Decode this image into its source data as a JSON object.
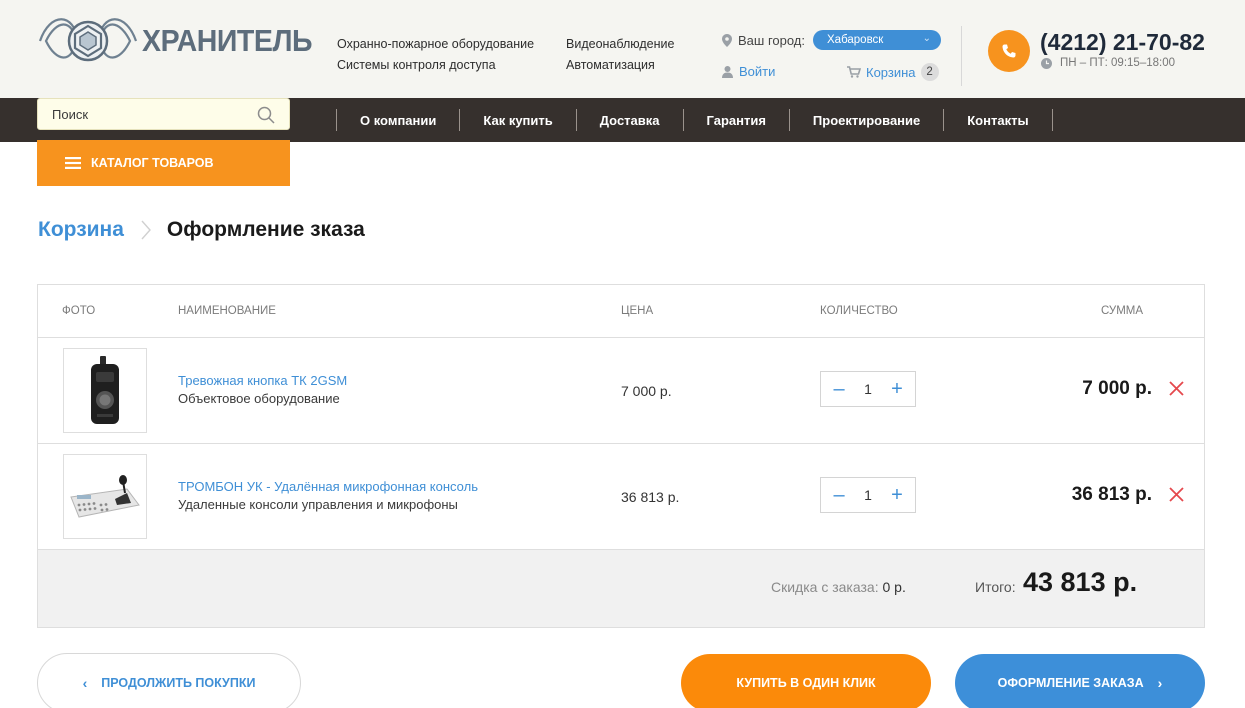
{
  "header": {
    "logo_text": "ХРАНИТЕЛЬ",
    "top_links_col1": [
      "Охранно-пожарное оборудование",
      "Системы контроля доступа"
    ],
    "top_links_col2": [
      "Видеонаблюдение",
      "Автоматизация"
    ],
    "city_label": "Ваш город:",
    "city_value": "Хабаровск",
    "login_label": "Войти",
    "cart_label": "Корзина",
    "cart_count": "2",
    "phone": "(4212) 21-70-82",
    "hours": "ПН – ПТ: 09:15–18:00"
  },
  "navbar": {
    "search_placeholder": "Поиск",
    "items": [
      "О компании",
      "Как купить",
      "Доставка",
      "Гарантия",
      "Проектирование",
      "Контакты"
    ]
  },
  "catalog_label": "КАТАЛОГ ТОВАРОВ",
  "breadcrumb": {
    "link": "Корзина",
    "current": "Оформление зказа"
  },
  "table": {
    "headers": [
      "ФОТО",
      "НАИМЕНОВАНИЕ",
      "ЦЕНА",
      "КОЛИЧЕСТВО",
      "СУММА"
    ],
    "rows": [
      {
        "name": "Тревожная кнопка ТК 2GSM",
        "category": "Объектовое оборудование",
        "price": "7 000 р.",
        "qty": "1",
        "sum": "7 000 р."
      },
      {
        "name": "ТРОМБОН УК - Удалённая микрофонная консоль",
        "category": "Удаленные консоли управления и микрофоны",
        "price": "36 813 р.",
        "qty": "1",
        "sum": "36 813 р."
      }
    ],
    "discount_label": "Скидка с заказа:",
    "discount_value": "0 р.",
    "total_label": "Итого:",
    "total_value": "43 813 р."
  },
  "buttons": {
    "continue": "ПРОДОЛЖИТЬ ПОКУПКИ",
    "one_click": "КУПИТЬ В ОДИН КЛИК",
    "order": "ОФОРМЛЕНИЕ ЗАКАЗА"
  },
  "colors": {
    "accent_blue": "#3f8fd6",
    "accent_orange": "#f7931e",
    "navbar_bg": "#36302d",
    "delete_red": "#e5484d"
  }
}
